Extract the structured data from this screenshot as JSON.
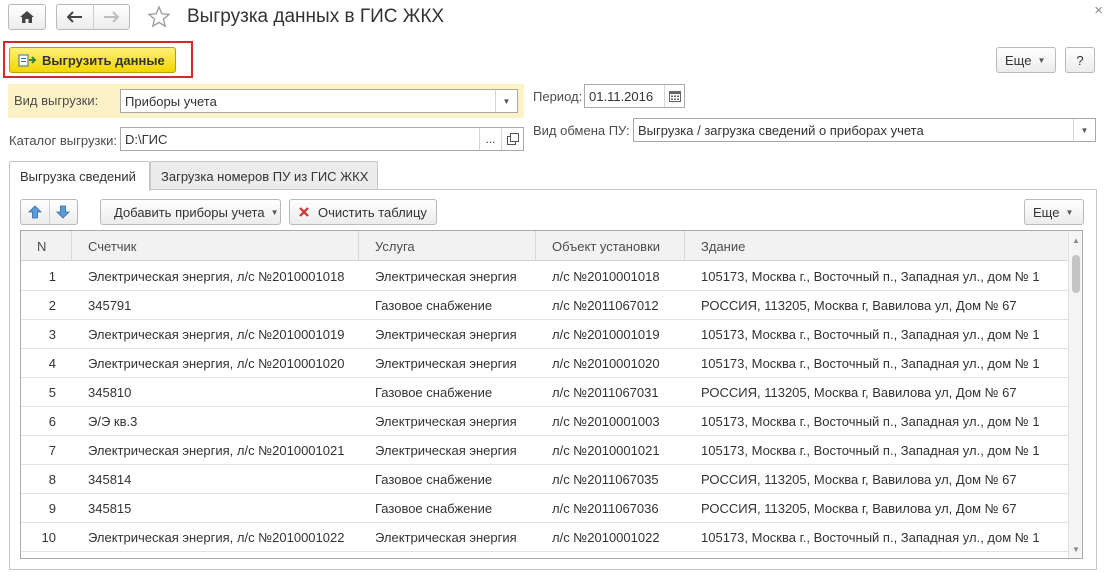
{
  "window": {
    "title": "Выгрузка данных в ГИС ЖКХ",
    "close_glyph": "×"
  },
  "icons": {
    "home": "home-icon",
    "back": "arrow-left-icon",
    "forward": "arrow-right-icon",
    "favorite": "star-icon",
    "upload": "upload-icon",
    "calendar": "calendar-icon",
    "open": "open-icon",
    "move_up": "arrow-up-icon",
    "move_down": "arrow-down-icon",
    "clear": "red-cross-icon"
  },
  "toolbar": {
    "upload_label": "Выгрузить данные",
    "more_label": "Еще",
    "help_label": "?"
  },
  "form": {
    "export_type_label": "Вид выгрузки:",
    "export_type_value": "Приборы учета",
    "period_label": "Период:",
    "period_value": "01.11.2016",
    "catalog_label": "Каталог выгрузки:",
    "catalog_value": "D:\\ГИС",
    "catalog_browse": "...",
    "exchange_label": "Вид обмена ПУ:",
    "exchange_value": "Выгрузка / загрузка сведений о приборах учета"
  },
  "tabs": [
    {
      "label": "Выгрузка сведений",
      "active": true
    },
    {
      "label": "Загрузка номеров ПУ из ГИС ЖКХ",
      "active": false
    }
  ],
  "table_toolbar": {
    "add_devices_label": "Добавить приборы учета",
    "clear_label": "Очистить таблицу",
    "more_label": "Еще"
  },
  "table": {
    "columns": [
      "N",
      "Счетчик",
      "Услуга",
      "Объект установки",
      "Здание"
    ],
    "rows": [
      [
        "1",
        "Электрическая энергия, л/с №2010001018",
        "Электрическая энергия",
        "л/с №2010001018",
        "105173, Москва г., Восточный п., Западная ул., дом № 1"
      ],
      [
        "2",
        "345791",
        "Газовое снабжение",
        "л/с №2011067012",
        "РОССИЯ, 113205, Москва г, Вавилова ул, Дом № 67"
      ],
      [
        "3",
        "Электрическая энергия, л/с №2010001019",
        "Электрическая энергия",
        "л/с №2010001019",
        "105173, Москва г., Восточный п., Западная ул., дом № 1"
      ],
      [
        "4",
        "Электрическая энергия, л/с №2010001020",
        "Электрическая энергия",
        "л/с №2010001020",
        "105173, Москва г., Восточный п., Западная ул., дом № 1"
      ],
      [
        "5",
        "345810",
        "Газовое снабжение",
        "л/с №2011067031",
        "РОССИЯ, 113205, Москва г, Вавилова ул, Дом № 67"
      ],
      [
        "6",
        "Э/Э кв.3",
        "Электрическая энергия",
        "л/с №2010001003",
        "105173, Москва г., Восточный п., Западная ул., дом № 1"
      ],
      [
        "7",
        "Электрическая энергия, л/с №2010001021",
        "Электрическая энергия",
        "л/с №2010001021",
        "105173, Москва г., Восточный п., Западная ул., дом № 1"
      ],
      [
        "8",
        "345814",
        "Газовое снабжение",
        "л/с №2011067035",
        "РОССИЯ, 113205, Москва г, Вавилова ул, Дом № 67"
      ],
      [
        "9",
        "345815",
        "Газовое снабжение",
        "л/с №2011067036",
        "РОССИЯ, 113205, Москва г, Вавилова ул, Дом № 67"
      ],
      [
        "10",
        "Электрическая энергия, л/с №2010001022",
        "Электрическая энергия",
        "л/с №2010001022",
        "105173, Москва г., Восточный п., Западная ул., дом № 1"
      ]
    ]
  },
  "colors": {
    "primary_button": "#f5dc1e",
    "highlight_frame": "#d7272a",
    "highlight_row": "#fdf1c8"
  }
}
